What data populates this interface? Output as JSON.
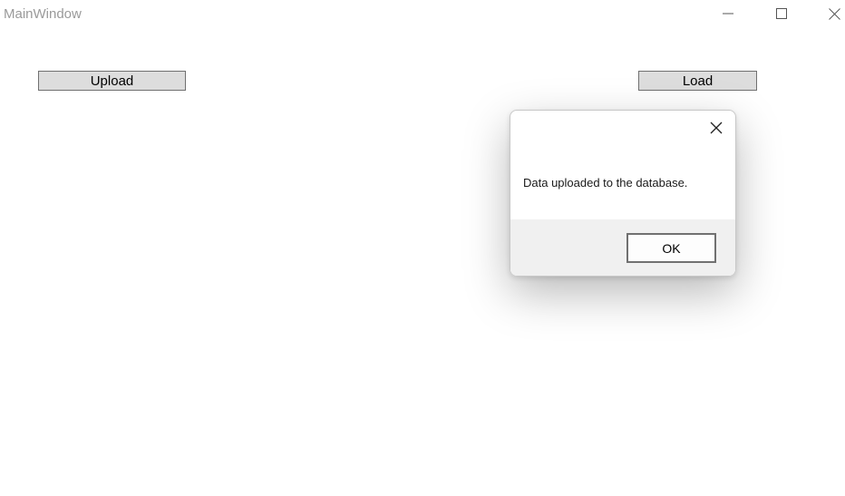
{
  "window": {
    "title": "MainWindow",
    "controls": {
      "minimize_icon": "minimize-icon",
      "maximize_icon": "maximize-icon",
      "close_icon": "close-icon"
    }
  },
  "main": {
    "upload_label": "Upload",
    "load_label": "Load"
  },
  "dialog": {
    "message": "Data uploaded to the database.",
    "ok_label": "OK",
    "close_icon": "close-icon"
  }
}
